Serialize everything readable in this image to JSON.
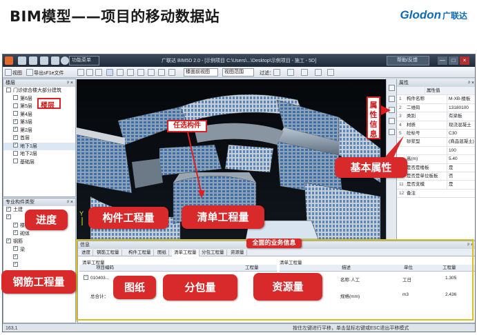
{
  "slide": {
    "title": "BIM模型——项目的移动数据站",
    "logo_word": "Glodon",
    "logo_cn": "广联达"
  },
  "window": {
    "title": "广联达 BIM5D 2.0 - [示例项目 C:\\Users\\...\\Desktop\\示例项目 - 施工 - 5D]",
    "menu_label": "功能菜单",
    "help_label": "帮助/反馈",
    "min": "—",
    "max": "□",
    "close": "×"
  },
  "toolbar": {
    "view_label": "视图",
    "export_label": "导出sF1e文件",
    "select_1": "楼面前视图",
    "select_2": "视图范围",
    "mode_label": "切换",
    "filter_label": "过滤："
  },
  "floors": {
    "title": "楼层",
    "pin": "ᵖ ×",
    "root": "门诊综合楼大部分建筑",
    "items": [
      {
        "label": "第6层",
        "checked": false
      },
      {
        "label": "第5层",
        "checked": false
      },
      {
        "label": "第4层",
        "checked": false
      },
      {
        "label": "第3层",
        "checked": true
      },
      {
        "label": "第2层",
        "checked": true
      },
      {
        "label": "首层",
        "checked": true
      },
      {
        "label": "地下1层",
        "checked": true
      },
      {
        "label": "地下2层",
        "checked": false
      },
      {
        "label": "基础层",
        "checked": false
      }
    ]
  },
  "types": {
    "title": "专业构件类型",
    "pin": "ᵖ ×",
    "items": [
      {
        "label": "土建",
        "checked": true
      },
      {
        "label": "",
        "checked": true
      },
      {
        "label": "楼板",
        "checked": true
      },
      {
        "label": "砌体",
        "checked": true
      },
      {
        "label": "钢筋",
        "checked": true
      },
      {
        "label": "梁",
        "checked": true
      },
      {
        "label": "",
        "checked": true
      },
      {
        "label": "",
        "checked": true
      },
      {
        "label": "柱",
        "checked": true
      },
      {
        "label": "构造柱",
        "checked": true
      },
      {
        "label": "墙",
        "checked": true
      }
    ]
  },
  "properties": {
    "title": "属性",
    "pin": "ᵖ ×",
    "header": "属性值",
    "rows": [
      {
        "n": "1",
        "k": "构件名称",
        "v": "M-XB-楼板"
      },
      {
        "n": "2",
        "k": "二维码",
        "v": "13180100"
      },
      {
        "n": "3",
        "k": "类别",
        "v": "有梁板"
      },
      {
        "n": "4",
        "k": "材质",
        "v": "现浇混凝土"
      },
      {
        "n": "5",
        "k": "砼标号",
        "v": "C30"
      },
      {
        "n": "",
        "k": "砂浆型",
        "v": "(商品混凝土)"
      },
      {
        "n": "",
        "k": "",
        "v": "100"
      },
      {
        "n": "",
        "k": "高(m)",
        "v": "5.40"
      },
      {
        "n": "",
        "k": "是否是楼板",
        "v": "是"
      },
      {
        "n": "10",
        "k": "是否是单位板板",
        "v": "否"
      },
      {
        "n": "11",
        "k": "是否支模",
        "v": "是"
      },
      {
        "n": "12",
        "k": "备注",
        "v": ""
      }
    ]
  },
  "info": {
    "title": "信息",
    "tabs": [
      "进度",
      "钢筋工程量",
      "构件工程量",
      "图纸",
      "清单工程量",
      "分包工程量",
      "资源量"
    ],
    "left_title": "清单工程量",
    "right_title": "清单工程量",
    "col_project": "项目编码",
    "col_qty": "工程量",
    "row1_code": "010403...",
    "row_total": "总合计：",
    "right_cols": [
      "描述",
      "单位",
      "工程量"
    ],
    "right_rows": [
      {
        "desc": "名称·人工",
        "unit": "工日",
        "qty": "1.305"
      },
      {
        "desc": "规格(mm)",
        "unit": "m3",
        "qty": "2.436"
      }
    ]
  },
  "status": {
    "left": "163,1",
    "right": "按住左键进行平移，单击鼠标右键或ESC退出平移模式"
  },
  "annotations": {
    "floors_tag": "楼层",
    "select_tag": "任选构件",
    "attr_tag": "属性信息",
    "basic_attr": "基本属性",
    "progress": "进度",
    "component_qty": "构件工程量",
    "bill_qty": "清单工程量",
    "rebar_qty": "钢筋工程量",
    "drawing": "图纸",
    "subcontract": "分包量",
    "resource": "资源量",
    "business_info": "全面的业务信息"
  }
}
